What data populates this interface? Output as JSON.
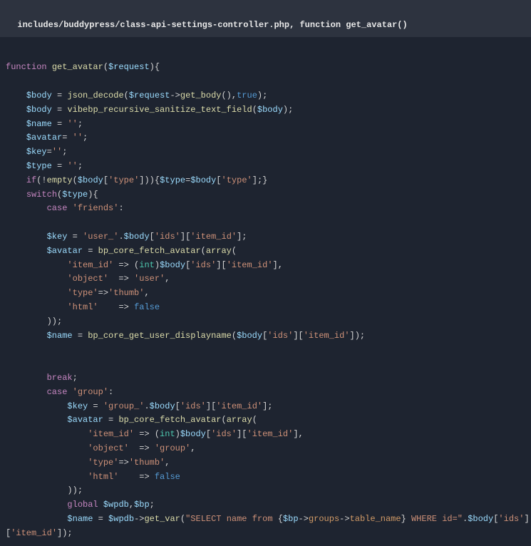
{
  "header": {
    "text": "includes/buddypress/class-api-settings-controller.php, function get_avatar()"
  },
  "code": {
    "lines": [
      [],
      [
        {
          "t": "function ",
          "c": "kw"
        },
        {
          "t": "get_avatar",
          "c": "fn"
        },
        {
          "t": "(",
          "c": "op"
        },
        {
          "t": "$request",
          "c": "var"
        },
        {
          "t": "){",
          "c": "op"
        }
      ],
      [],
      [
        {
          "t": "    ",
          "c": "op"
        },
        {
          "t": "$body",
          "c": "var"
        },
        {
          "t": " = ",
          "c": "op"
        },
        {
          "t": "json_decode",
          "c": "fn"
        },
        {
          "t": "(",
          "c": "op"
        },
        {
          "t": "$request",
          "c": "var"
        },
        {
          "t": "->",
          "c": "op"
        },
        {
          "t": "get_body",
          "c": "fn"
        },
        {
          "t": "(),",
          "c": "op"
        },
        {
          "t": "true",
          "c": "arr"
        },
        {
          "t": ");",
          "c": "op"
        }
      ],
      [
        {
          "t": "    ",
          "c": "op"
        },
        {
          "t": "$body",
          "c": "var"
        },
        {
          "t": " = ",
          "c": "op"
        },
        {
          "t": "vibebp_recursive_sanitize_text_field",
          "c": "fn"
        },
        {
          "t": "(",
          "c": "op"
        },
        {
          "t": "$body",
          "c": "var"
        },
        {
          "t": ");",
          "c": "op"
        }
      ],
      [
        {
          "t": "    ",
          "c": "op"
        },
        {
          "t": "$name",
          "c": "var"
        },
        {
          "t": " = ",
          "c": "op"
        },
        {
          "t": "''",
          "c": "str"
        },
        {
          "t": ";",
          "c": "op"
        }
      ],
      [
        {
          "t": "    ",
          "c": "op"
        },
        {
          "t": "$avatar",
          "c": "var"
        },
        {
          "t": "= ",
          "c": "op"
        },
        {
          "t": "''",
          "c": "str"
        },
        {
          "t": ";",
          "c": "op"
        }
      ],
      [
        {
          "t": "    ",
          "c": "op"
        },
        {
          "t": "$key",
          "c": "var"
        },
        {
          "t": "=",
          "c": "op"
        },
        {
          "t": "''",
          "c": "str"
        },
        {
          "t": ";",
          "c": "op"
        }
      ],
      [
        {
          "t": "    ",
          "c": "op"
        },
        {
          "t": "$type",
          "c": "var"
        },
        {
          "t": " = ",
          "c": "op"
        },
        {
          "t": "''",
          "c": "str"
        },
        {
          "t": ";",
          "c": "op"
        }
      ],
      [
        {
          "t": "    ",
          "c": "op"
        },
        {
          "t": "if",
          "c": "kw"
        },
        {
          "t": "(!",
          "c": "op"
        },
        {
          "t": "empty",
          "c": "fn"
        },
        {
          "t": "(",
          "c": "op"
        },
        {
          "t": "$body",
          "c": "var"
        },
        {
          "t": "[",
          "c": "op"
        },
        {
          "t": "'type'",
          "c": "str"
        },
        {
          "t": "])){",
          "c": "op"
        },
        {
          "t": "$type",
          "c": "var"
        },
        {
          "t": "=",
          "c": "op"
        },
        {
          "t": "$body",
          "c": "var"
        },
        {
          "t": "[",
          "c": "op"
        },
        {
          "t": "'type'",
          "c": "str"
        },
        {
          "t": "];}",
          "c": "op"
        }
      ],
      [
        {
          "t": "    ",
          "c": "op"
        },
        {
          "t": "switch",
          "c": "kw"
        },
        {
          "t": "(",
          "c": "op"
        },
        {
          "t": "$type",
          "c": "var"
        },
        {
          "t": "){",
          "c": "op"
        }
      ],
      [
        {
          "t": "        ",
          "c": "op"
        },
        {
          "t": "case",
          "c": "kw"
        },
        {
          "t": " ",
          "c": "op"
        },
        {
          "t": "'friends'",
          "c": "str"
        },
        {
          "t": ":",
          "c": "op"
        }
      ],
      [],
      [
        {
          "t": "        ",
          "c": "op"
        },
        {
          "t": "$key",
          "c": "var"
        },
        {
          "t": " = ",
          "c": "op"
        },
        {
          "t": "'user_'",
          "c": "str"
        },
        {
          "t": ".",
          "c": "op"
        },
        {
          "t": "$body",
          "c": "var"
        },
        {
          "t": "[",
          "c": "op"
        },
        {
          "t": "'ids'",
          "c": "str"
        },
        {
          "t": "][",
          "c": "op"
        },
        {
          "t": "'item_id'",
          "c": "str"
        },
        {
          "t": "];",
          "c": "op"
        }
      ],
      [
        {
          "t": "        ",
          "c": "op"
        },
        {
          "t": "$avatar",
          "c": "var"
        },
        {
          "t": " = ",
          "c": "op"
        },
        {
          "t": "bp_core_fetch_avatar",
          "c": "fn"
        },
        {
          "t": "(",
          "c": "op"
        },
        {
          "t": "array",
          "c": "fn"
        },
        {
          "t": "(",
          "c": "op"
        }
      ],
      [
        {
          "t": "            ",
          "c": "op"
        },
        {
          "t": "'item_id'",
          "c": "str"
        },
        {
          "t": " => (",
          "c": "op"
        },
        {
          "t": "int",
          "c": "obj"
        },
        {
          "t": ")",
          "c": "op"
        },
        {
          "t": "$body",
          "c": "var"
        },
        {
          "t": "[",
          "c": "op"
        },
        {
          "t": "'ids'",
          "c": "str"
        },
        {
          "t": "][",
          "c": "op"
        },
        {
          "t": "'item_id'",
          "c": "str"
        },
        {
          "t": "],",
          "c": "op"
        }
      ],
      [
        {
          "t": "            ",
          "c": "op"
        },
        {
          "t": "'object'",
          "c": "str"
        },
        {
          "t": "  => ",
          "c": "op"
        },
        {
          "t": "'user'",
          "c": "str"
        },
        {
          "t": ",",
          "c": "op"
        }
      ],
      [
        {
          "t": "            ",
          "c": "op"
        },
        {
          "t": "'type'",
          "c": "str"
        },
        {
          "t": "=>",
          "c": "op"
        },
        {
          "t": "'thumb'",
          "c": "str"
        },
        {
          "t": ",",
          "c": "op"
        }
      ],
      [
        {
          "t": "            ",
          "c": "op"
        },
        {
          "t": "'html'",
          "c": "str"
        },
        {
          "t": "    => ",
          "c": "op"
        },
        {
          "t": "false",
          "c": "arr"
        }
      ],
      [
        {
          "t": "        ));",
          "c": "op"
        }
      ],
      [
        {
          "t": "        ",
          "c": "op"
        },
        {
          "t": "$name",
          "c": "var"
        },
        {
          "t": " = ",
          "c": "op"
        },
        {
          "t": "bp_core_get_user_displayname",
          "c": "fn"
        },
        {
          "t": "(",
          "c": "op"
        },
        {
          "t": "$body",
          "c": "var"
        },
        {
          "t": "[",
          "c": "op"
        },
        {
          "t": "'ids'",
          "c": "str"
        },
        {
          "t": "][",
          "c": "op"
        },
        {
          "t": "'item_id'",
          "c": "str"
        },
        {
          "t": "]);",
          "c": "op"
        }
      ],
      [],
      [],
      [
        {
          "t": "        ",
          "c": "op"
        },
        {
          "t": "break",
          "c": "kw"
        },
        {
          "t": ";",
          "c": "op"
        }
      ],
      [
        {
          "t": "        ",
          "c": "op"
        },
        {
          "t": "case",
          "c": "kw"
        },
        {
          "t": " ",
          "c": "op"
        },
        {
          "t": "'group'",
          "c": "str"
        },
        {
          "t": ":",
          "c": "op"
        }
      ],
      [
        {
          "t": "            ",
          "c": "op"
        },
        {
          "t": "$key",
          "c": "var"
        },
        {
          "t": " = ",
          "c": "op"
        },
        {
          "t": "'group_'",
          "c": "str"
        },
        {
          "t": ".",
          "c": "op"
        },
        {
          "t": "$body",
          "c": "var"
        },
        {
          "t": "[",
          "c": "op"
        },
        {
          "t": "'ids'",
          "c": "str"
        },
        {
          "t": "][",
          "c": "op"
        },
        {
          "t": "'item_id'",
          "c": "str"
        },
        {
          "t": "];",
          "c": "op"
        }
      ],
      [
        {
          "t": "            ",
          "c": "op"
        },
        {
          "t": "$avatar",
          "c": "var"
        },
        {
          "t": " = ",
          "c": "op"
        },
        {
          "t": "bp_core_fetch_avatar",
          "c": "fn"
        },
        {
          "t": "(",
          "c": "op"
        },
        {
          "t": "array",
          "c": "fn"
        },
        {
          "t": "(",
          "c": "op"
        }
      ],
      [
        {
          "t": "                ",
          "c": "op"
        },
        {
          "t": "'item_id'",
          "c": "str"
        },
        {
          "t": " => (",
          "c": "op"
        },
        {
          "t": "int",
          "c": "obj"
        },
        {
          "t": ")",
          "c": "op"
        },
        {
          "t": "$body",
          "c": "var"
        },
        {
          "t": "[",
          "c": "op"
        },
        {
          "t": "'ids'",
          "c": "str"
        },
        {
          "t": "][",
          "c": "op"
        },
        {
          "t": "'item_id'",
          "c": "str"
        },
        {
          "t": "],",
          "c": "op"
        }
      ],
      [
        {
          "t": "                ",
          "c": "op"
        },
        {
          "t": "'object'",
          "c": "str"
        },
        {
          "t": "  => ",
          "c": "op"
        },
        {
          "t": "'group'",
          "c": "str"
        },
        {
          "t": ",",
          "c": "op"
        }
      ],
      [
        {
          "t": "                ",
          "c": "op"
        },
        {
          "t": "'type'",
          "c": "str"
        },
        {
          "t": "=>",
          "c": "op"
        },
        {
          "t": "'thumb'",
          "c": "str"
        },
        {
          "t": ",",
          "c": "op"
        }
      ],
      [
        {
          "t": "                ",
          "c": "op"
        },
        {
          "t": "'html'",
          "c": "str"
        },
        {
          "t": "    => ",
          "c": "op"
        },
        {
          "t": "false",
          "c": "arr"
        }
      ],
      [
        {
          "t": "            ));",
          "c": "op"
        }
      ],
      [
        {
          "t": "            ",
          "c": "op"
        },
        {
          "t": "global",
          "c": "kw"
        },
        {
          "t": " ",
          "c": "op"
        },
        {
          "t": "$wpdb",
          "c": "var"
        },
        {
          "t": ",",
          "c": "op"
        },
        {
          "t": "$bp",
          "c": "var"
        },
        {
          "t": ";",
          "c": "op"
        }
      ],
      [
        {
          "t": "            ",
          "c": "op"
        },
        {
          "t": "$name",
          "c": "var"
        },
        {
          "t": " = ",
          "c": "op"
        },
        {
          "t": "$wpdb",
          "c": "var"
        },
        {
          "t": "->",
          "c": "op"
        },
        {
          "t": "get_var",
          "c": "fn"
        },
        {
          "t": "(",
          "c": "op"
        },
        {
          "t": "\"SELECT name from ",
          "c": "str"
        },
        {
          "t": "{",
          "c": "op"
        },
        {
          "t": "$bp",
          "c": "var"
        },
        {
          "t": "->",
          "c": "op"
        },
        {
          "t": "groups",
          "c": "prop"
        },
        {
          "t": "->",
          "c": "op"
        },
        {
          "t": "table_name",
          "c": "prop"
        },
        {
          "t": "}",
          "c": "op"
        },
        {
          "t": " WHERE id=\"",
          "c": "str"
        },
        {
          "t": ".",
          "c": "op"
        },
        {
          "t": "$body",
          "c": "var"
        },
        {
          "t": "[",
          "c": "op"
        },
        {
          "t": "'ids'",
          "c": "str"
        },
        {
          "t": "]",
          "c": "op"
        }
      ],
      [
        {
          "t": "[",
          "c": "op"
        },
        {
          "t": "'item_id'",
          "c": "str"
        },
        {
          "t": "]);",
          "c": "op"
        }
      ]
    ]
  }
}
